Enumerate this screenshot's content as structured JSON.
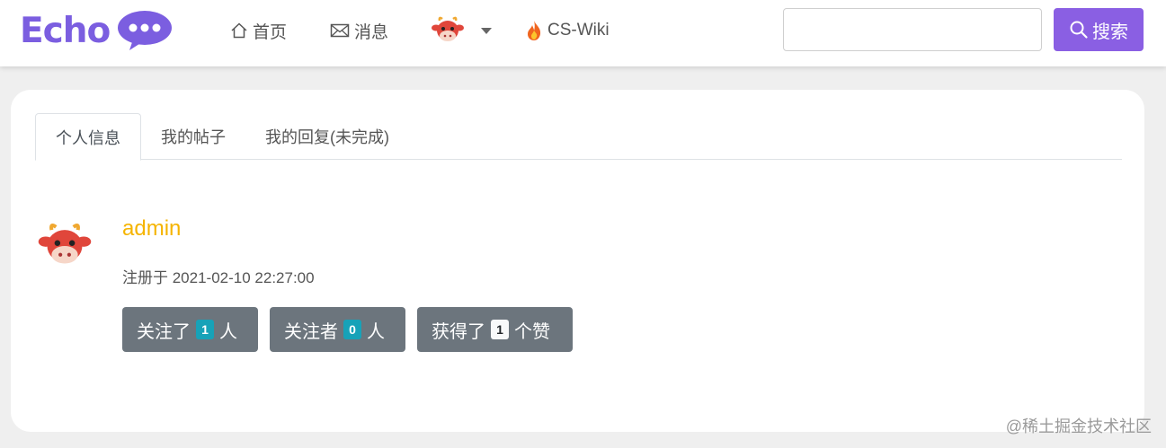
{
  "header": {
    "logo_text": "Echo",
    "nav": {
      "home": "首页",
      "messages": "消息",
      "wiki": "CS-Wiki"
    },
    "search": {
      "placeholder": "",
      "button_label": "搜索"
    },
    "colors": {
      "brand": "#7b5ee0",
      "search_button": "#8a5fe3"
    }
  },
  "profile": {
    "tabs": [
      "个人信息",
      "我的帖子",
      "我的回复(未完成)"
    ],
    "active_tab": "个人信息",
    "username": "admin",
    "registered": "注册于 2021-02-10 22:27:00",
    "stats": [
      {
        "prefix": "关注了",
        "count": "1",
        "suffix": "人"
      },
      {
        "prefix": "关注者",
        "count": "0",
        "suffix": "人"
      },
      {
        "prefix": "获得了",
        "count": "1",
        "suffix": "个赞"
      }
    ],
    "colors": {
      "username": "#f5b400",
      "stat_button": "#6c757d",
      "badge_info": "#17a2b8"
    }
  },
  "watermark": "@稀土掘金技术社区",
  "icons": [
    "home-icon",
    "envelope-icon",
    "cow-avatar-icon",
    "fire-icon",
    "search-icon",
    "chat-bubble-icon"
  ]
}
